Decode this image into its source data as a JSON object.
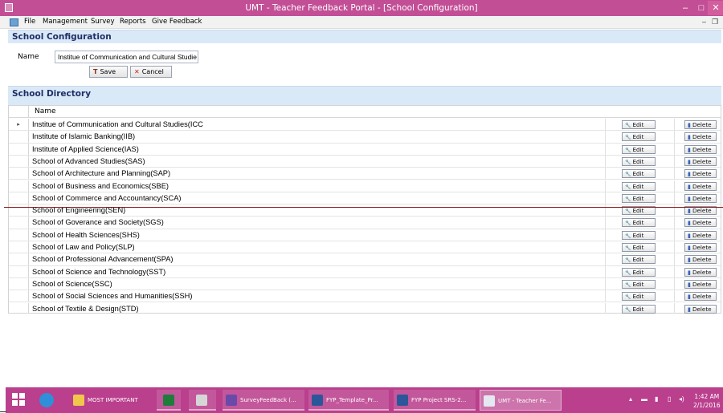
{
  "window": {
    "title": "UMT - Teacher Feedback Portal - [School Configuration]",
    "controls": {
      "minimize": "–",
      "maximize": "□",
      "close": "✕"
    }
  },
  "menubar": {
    "items": [
      "File",
      "Management",
      "Survey",
      "Reports",
      "Give Feedback"
    ],
    "mdi_minimize": "–",
    "mdi_restore": "❐"
  },
  "config_panel": {
    "header": "School Configuration",
    "name_label": "Name",
    "name_value": "Institue of Communication and Cultural Studie",
    "save_label": "Save",
    "cancel_label": "Cancel"
  },
  "directory_panel": {
    "header": "School Directory",
    "column_header": "Name",
    "edit_label": "Edit",
    "delete_label": "Delete",
    "current_row_marker": "▸",
    "rows": [
      "Institue of Communication and Cultural Studies(ICC",
      "Institute of Islamic Banking(IIB)",
      "Institute of Applied Science(IAS)",
      "School of Advanced Studies(SAS)",
      "School of Architecture and Planning(SAP)",
      "School of Business and Economics(SBE)",
      "School of Commerce and Accountancy(SCA)",
      "School of Engineering(SEN)",
      "School of Goverance and Society(SGS)",
      "School of Health Sciences(SHS)",
      "School of Law and Policy(SLP)",
      "School of Professional Advancement(SPA)",
      "School of Science and Technology(SST)",
      "School of Science(SSC)",
      "School of Social Sciences and Humanities(SSH)",
      "School of Textile & Design(STD)"
    ]
  },
  "taskbar": {
    "items": [
      {
        "label": "MOST IMPORTANT",
        "icon": "folder-icon"
      },
      {
        "label": "",
        "icon": "excel-icon"
      },
      {
        "label": "",
        "icon": "snipping-tool-icon"
      },
      {
        "label": "SurveyFeedBack (...",
        "icon": "visual-studio-icon"
      },
      {
        "label": "FYP_Template_Pr...",
        "icon": "word-icon"
      },
      {
        "label": "FYP Project SRS-2...",
        "icon": "word-icon"
      },
      {
        "label": "UMT - Teacher Fe...",
        "icon": "app-window-icon"
      }
    ],
    "clock_time": "1:42 AM",
    "clock_date": "2/1/2016"
  },
  "colors": {
    "titlebar": "#c24f96",
    "taskbar": "#ba3f8d",
    "panel_header": "#dae9f8",
    "panel_header_text": "#1f2f66"
  }
}
